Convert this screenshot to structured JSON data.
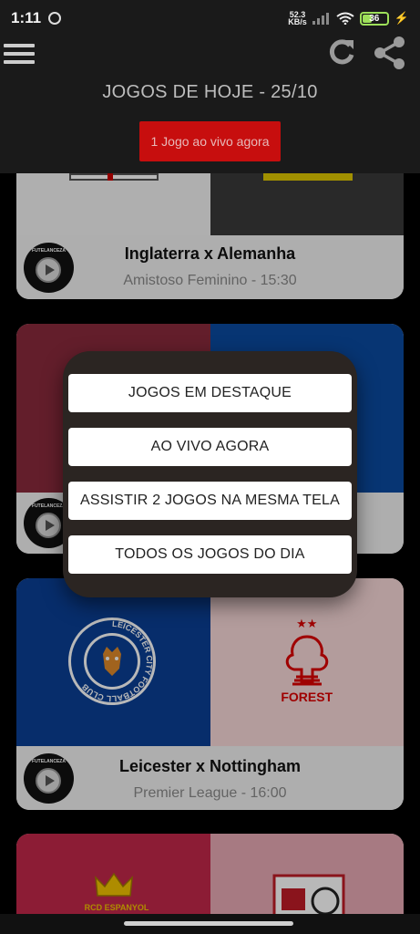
{
  "status_bar": {
    "time": "1:11",
    "net_speed_value": "52.3",
    "net_speed_unit": "KB/s",
    "battery": "36"
  },
  "header": {
    "title": "JOGOS DE HOJE - 25/10",
    "live_button": "1 Jogo ao vivo agora"
  },
  "cards": [
    {
      "match": "Inglaterra x Alemanha",
      "league": "Amistoso Feminino - 15:30",
      "channel_brand": "FUTELANCEZA"
    },
    {
      "match": "",
      "league": "",
      "channel_brand": "FUTELANCEZA"
    },
    {
      "match": "Leicester x Nottingham",
      "league": "Premier League - 16:00",
      "channel_brand": "FUTELANCEZA"
    },
    {
      "match": "",
      "league": ""
    }
  ],
  "logos": {
    "leicester_ring_text": "LEICESTER CITY FOOTBALL CLUB",
    "forest_text": "FOREST",
    "espanyol_text": "RCD ESPANYOL"
  },
  "dialog": {
    "buttons": [
      "JOGOS EM DESTAQUE",
      "AO VIVO AGORA",
      "ASSISTIR 2 JOGOS NA MESMA TELA",
      "TODOS OS JOGOS DO DIA"
    ]
  },
  "colors": {
    "live_red": "#c70e0e",
    "leicester_blue": "#0a3f95",
    "forest_red": "#dd0000",
    "dialog_bg": "#2b2522"
  }
}
